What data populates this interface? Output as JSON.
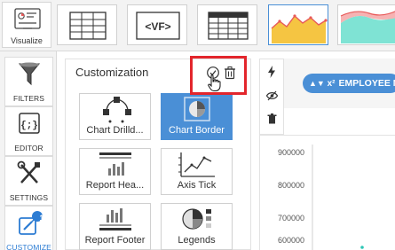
{
  "toolbar": {
    "visualize_label": "Visualize",
    "thumbnails": [
      {
        "icon": "table-icon"
      },
      {
        "icon": "html-vf-icon",
        "label": "<VF>"
      },
      {
        "icon": "pivot-table-icon"
      },
      {
        "icon": "area-chart-icon"
      },
      {
        "icon": "stacked-area-chart-icon"
      }
    ]
  },
  "rail": {
    "items": [
      {
        "label": "FILTERS",
        "icon": "funnel-icon"
      },
      {
        "label": "EDITOR",
        "icon": "code-braces-icon"
      },
      {
        "label": "SETTINGS",
        "icon": "wrench-screwdriver-icon"
      },
      {
        "label": "CUSTOMIZE",
        "icon": "customize-icon",
        "badge": "1",
        "active": true
      }
    ]
  },
  "panel": {
    "title": "Customization",
    "actions": [
      {
        "icon": "check-circle-icon"
      },
      {
        "icon": "trash-icon"
      }
    ],
    "tiles": [
      {
        "label": "Chart Drilld...",
        "icon": "chart-drilldown-icon"
      },
      {
        "label": "Chart Border",
        "icon": "chart-border-icon",
        "selected": true
      },
      {
        "label": "Report Hea...",
        "icon": "report-header-icon"
      },
      {
        "label": "Axis Tick",
        "icon": "axis-tick-icon"
      },
      {
        "label": "Report Footer",
        "icon": "report-footer-icon"
      },
      {
        "label": "Legends",
        "icon": "legends-icon"
      }
    ]
  },
  "side_actions": [
    {
      "icon": "lightning-icon"
    },
    {
      "icon": "eye-slash-icon"
    },
    {
      "icon": "trash-icon"
    }
  ],
  "field_pill": {
    "label": "EMPLOYEE N",
    "icon": "x-squared-sort-icon",
    "icon_text": "x²"
  },
  "chart": {
    "y_ticks": [
      "900000",
      "800000",
      "700000",
      "600000"
    ]
  },
  "colors": {
    "accent": "#4a8fd6",
    "highlight": "#e3262c",
    "area_fill": "#f5c542",
    "area_line": "#e85a5a",
    "teal_area": "#7fe3d4"
  }
}
